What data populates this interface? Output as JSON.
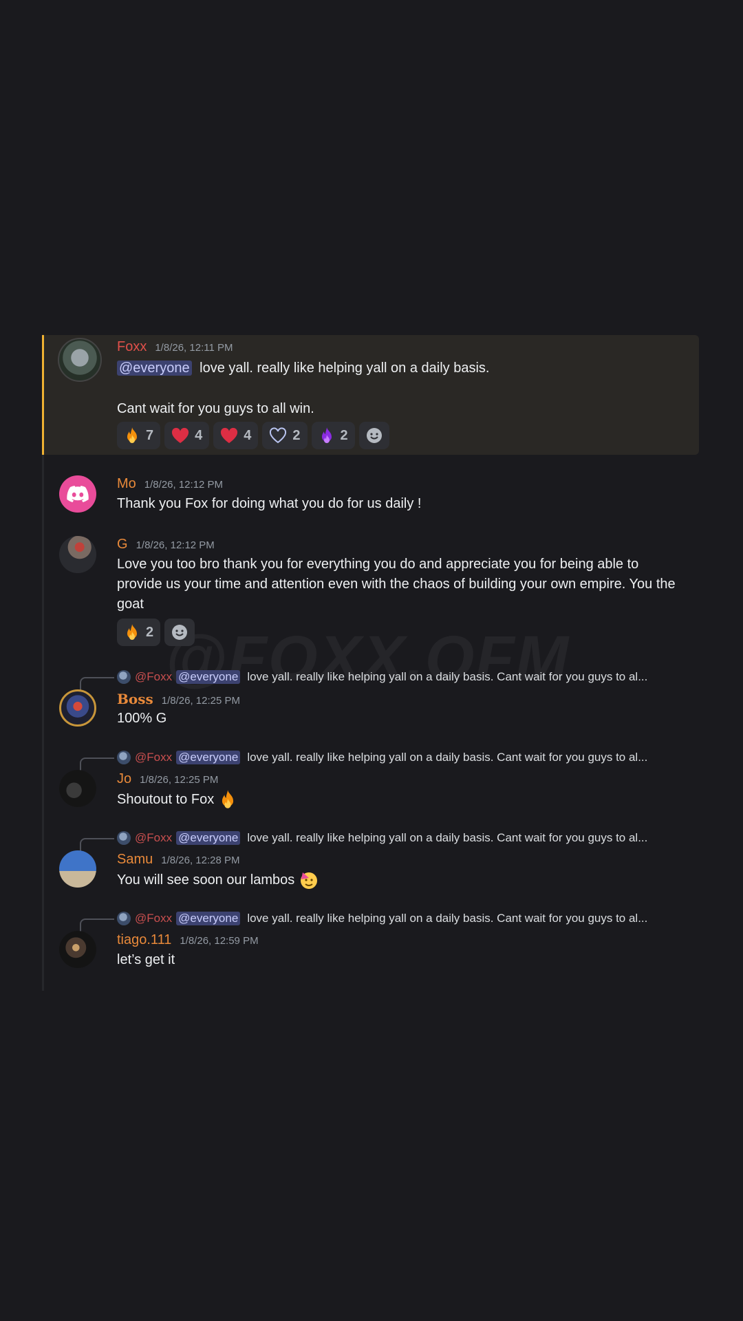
{
  "colors": {
    "background": "#1a1a1e",
    "highlight_bg": "#2a2825",
    "highlight_bar": "#f0b232",
    "mention_bg": "#3c4270",
    "mention_fg": "#c9cdfb",
    "name_red": "#e0504a",
    "name_orange": "#e8893a"
  },
  "watermark": "@FOXX.OFM",
  "messages": [
    {
      "author": "Foxx",
      "timestamp": "1/8/26, 12:11 PM",
      "mention": "@everyone",
      "line1": "love yall. really like helping yall on a daily basis.",
      "line2": "Cant wait for you guys to all win.",
      "reactions": [
        {
          "emoji": "fire-icon",
          "count": "7"
        },
        {
          "emoji": "heart-icon",
          "count": "4"
        },
        {
          "emoji": "heart-icon",
          "count": "4"
        },
        {
          "emoji": "heart-outline-icon",
          "count": "2"
        },
        {
          "emoji": "purple-fire-icon",
          "count": "2"
        }
      ]
    },
    {
      "author": "Mo",
      "timestamp": "1/8/26, 12:12 PM",
      "text": "Thank you Fox for doing what you do for us daily !"
    },
    {
      "author": "G",
      "timestamp": "1/8/26, 12:12 PM",
      "text": "Love you too bro thank you for everything you do and appreciate you for being able to provide us your time and attention even with the chaos of building your own empire. You the goat",
      "reactions": [
        {
          "emoji": "fire-icon",
          "count": "2"
        }
      ]
    },
    {
      "author": "Boss",
      "timestamp": "1/8/26, 12:25 PM",
      "text": "100% G"
    },
    {
      "author": "Jo",
      "timestamp": "1/8/26, 12:25 PM",
      "text": "Shoutout to Fox"
    },
    {
      "author": "Samu",
      "timestamp": "1/8/26, 12:28 PM",
      "text": "You will see soon our lambos"
    },
    {
      "author": "tiago.111",
      "timestamp": "1/8/26, 12:59 PM",
      "text": "let’s get it"
    }
  ],
  "reply": {
    "name": "@Foxx",
    "mention": "@everyone",
    "text": "love yall. really like helping yall on a daily basis.   Cant wait for you guys to al..."
  }
}
